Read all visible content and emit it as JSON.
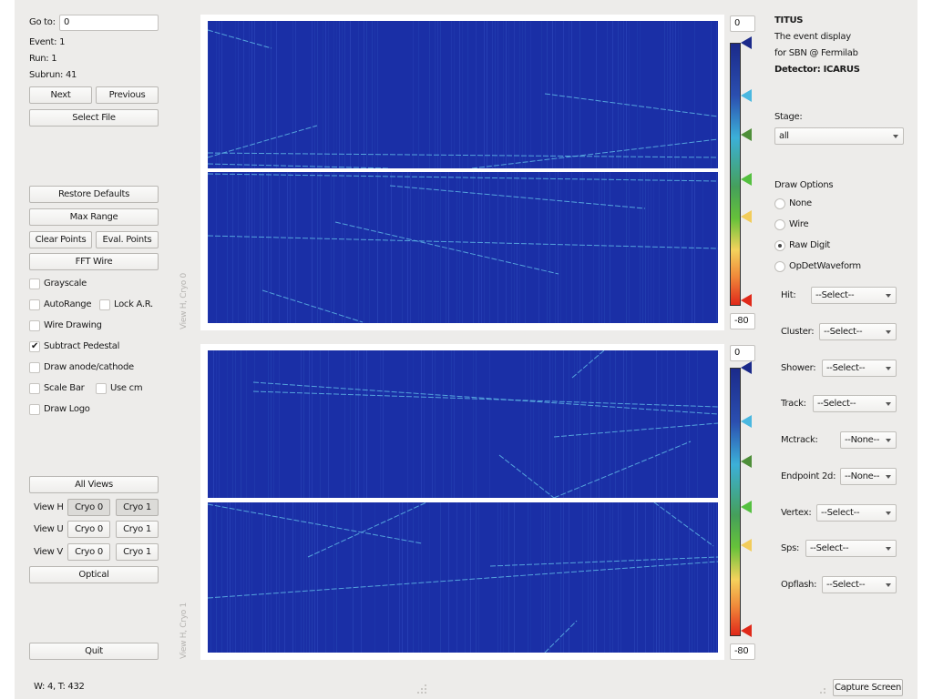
{
  "nav": {
    "goto_label": "Go to:",
    "goto_value": "0",
    "event": "Event: 1",
    "run": "Run: 1",
    "subrun": "Subrun: 41",
    "next": "Next",
    "previous": "Previous",
    "select_file": "Select File"
  },
  "controls": {
    "restore_defaults": "Restore Defaults",
    "max_range": "Max Range",
    "clear_points": "Clear Points",
    "eval_points": "Eval. Points",
    "fft_wire": "FFT Wire",
    "checkboxes": [
      {
        "label": "Grayscale",
        "checked": false
      },
      {
        "label": "AutoRange",
        "checked": false
      },
      {
        "label": "Lock A.R.",
        "checked": false
      },
      {
        "label": "Wire Drawing",
        "checked": false
      },
      {
        "label": "Subtract Pedestal",
        "checked": true
      },
      {
        "label": "Draw anode/cathode",
        "checked": false
      },
      {
        "label": "Scale Bar",
        "checked": false
      },
      {
        "label": "Use cm",
        "checked": false
      },
      {
        "label": "Draw Logo",
        "checked": false
      }
    ],
    "check_mark": "✔"
  },
  "views": {
    "all_views": "All Views",
    "rows": [
      {
        "label": "View H",
        "cryo0": "Cryo 0",
        "cryo1": "Cryo 1",
        "pressed": true
      },
      {
        "label": "View U",
        "cryo0": "Cryo 0",
        "cryo1": "Cryo 1",
        "pressed": false
      },
      {
        "label": "View V",
        "cryo0": "Cryo 0",
        "cryo1": "Cryo 1",
        "pressed": false
      }
    ],
    "optical": "Optical",
    "quit": "Quit"
  },
  "status": "W: 4, T: 432",
  "plots": [
    {
      "label": "View H, Cryo 0",
      "max": "0",
      "min": "-80"
    },
    {
      "label": "View H, Cryo 1",
      "max": "0",
      "min": "-80"
    }
  ],
  "colormap": {
    "stops": [
      "#1b2a8a",
      "#3cb0d8",
      "#45a05a",
      "#66c23a",
      "#f4d25c",
      "#e0281a"
    ],
    "marker_colors": [
      "#1b2a8a",
      "#4ab8e0",
      "#4f8f3a",
      "#55c040",
      "#f2cc5a",
      "#e02a1a"
    ]
  },
  "info": {
    "title": "TITUS",
    "line1": "The event display",
    "line2": "for SBN @ Fermilab",
    "detector": "Detector: ICARUS"
  },
  "stage": {
    "label": "Stage:",
    "value": "all"
  },
  "draw_options": {
    "title": "Draw Options",
    "options": [
      {
        "label": "None",
        "selected": false
      },
      {
        "label": "Wire",
        "selected": false
      },
      {
        "label": "Raw Digit",
        "selected": true
      },
      {
        "label": "OpDetWaveform",
        "selected": false
      }
    ]
  },
  "products": [
    {
      "label": "Hit:",
      "value": "--Select--"
    },
    {
      "label": "Cluster:",
      "value": "--Select--"
    },
    {
      "label": "Shower:",
      "value": "--Select--"
    },
    {
      "label": "Track:",
      "value": "--Select--"
    },
    {
      "label": "Mctrack:",
      "value": "--None--"
    },
    {
      "label": "Endpoint 2d:",
      "value": "--None--"
    },
    {
      "label": "Vertex:",
      "value": "--Select--"
    },
    {
      "label": "Sps:",
      "value": "--Select--"
    },
    {
      "label": "Opflash:",
      "value": "--Select--"
    }
  ],
  "capture_screen": "Capture Screen"
}
